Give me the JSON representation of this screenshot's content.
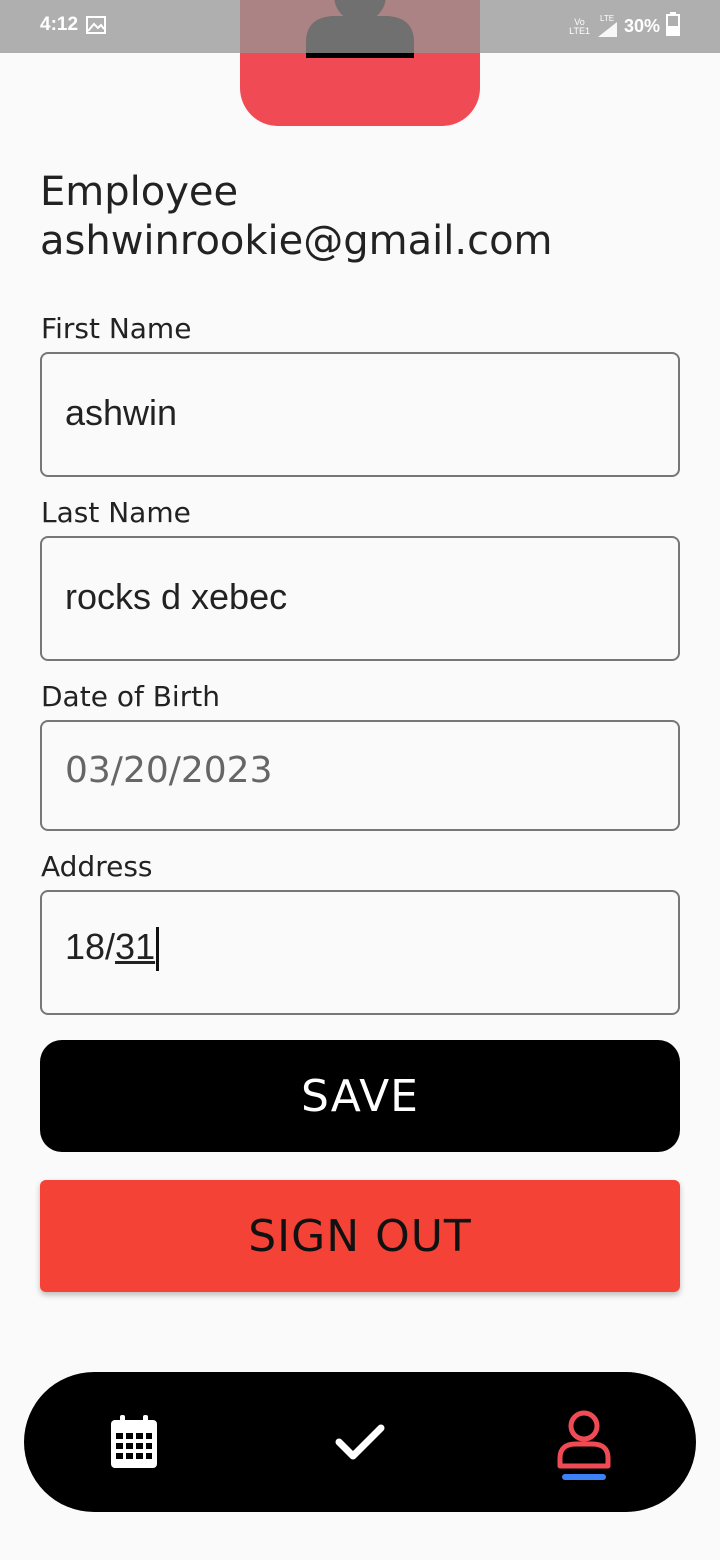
{
  "status_bar": {
    "time": "4:12",
    "network_line1": "Vo",
    "network_line2": "LTE1",
    "network_tag": "LTE",
    "battery": "30%"
  },
  "profile": {
    "role": "Employee",
    "email": "ashwinrookie@gmail.com"
  },
  "form": {
    "first_name": {
      "label": "First Name",
      "value": "ashwin"
    },
    "last_name": {
      "label": "Last Name",
      "value": "rocks d xebec"
    },
    "dob": {
      "label": "Date of Birth",
      "value": "03/20/2023"
    },
    "address": {
      "label": "Address",
      "value_prefix": "18/",
      "value_composing": "31"
    }
  },
  "buttons": {
    "save": "SAVE",
    "sign_out": "SIGN OUT"
  },
  "nav": {
    "items": [
      {
        "icon": "calendar-icon",
        "active": false
      },
      {
        "icon": "check-icon",
        "active": false
      },
      {
        "icon": "person-icon",
        "active": true
      }
    ]
  },
  "colors": {
    "accent_red": "#f04b55",
    "sign_out_red": "#f44336",
    "active_indicator": "#3b82f6"
  }
}
